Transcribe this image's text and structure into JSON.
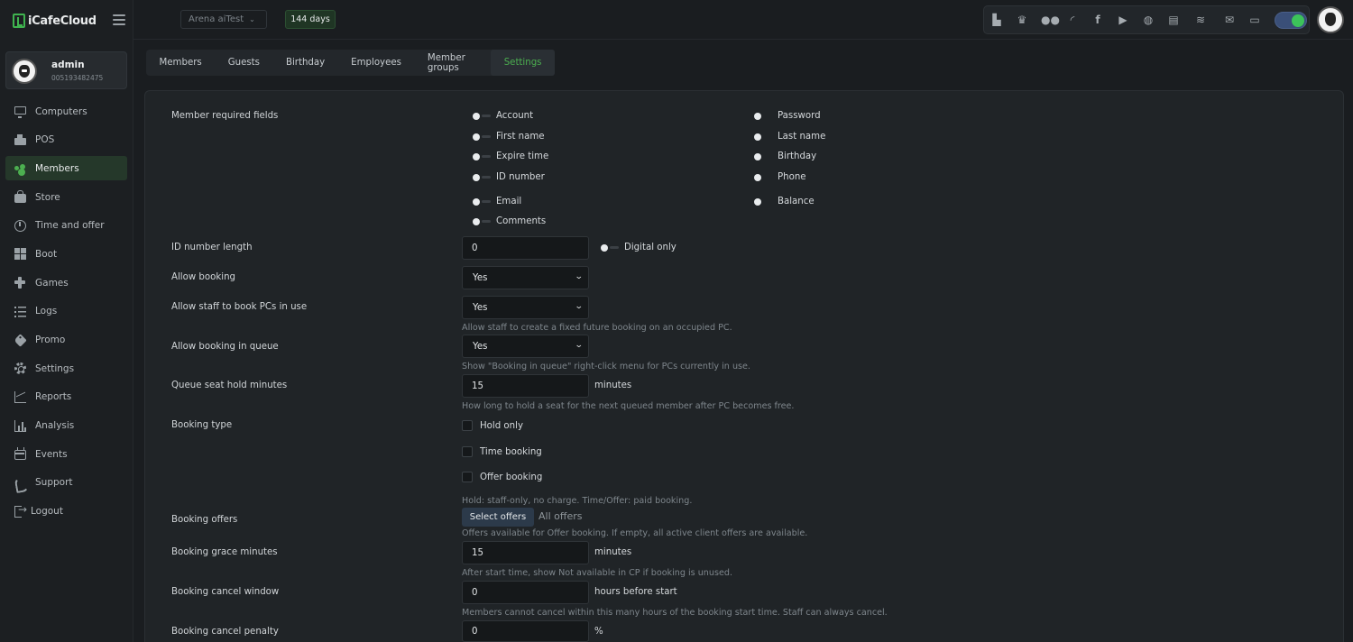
{
  "app": {
    "logo": "iCafeCloud"
  },
  "user": {
    "name": "admin",
    "id": "005193482475"
  },
  "nav": {
    "items": [
      {
        "label": "Computers",
        "icon": "computer-icon"
      },
      {
        "label": "POS",
        "icon": "pos-icon"
      },
      {
        "label": "Members",
        "icon": "members-icon",
        "active": true
      },
      {
        "label": "Store",
        "icon": "store-icon"
      },
      {
        "label": "Time and offer",
        "icon": "clock-icon"
      },
      {
        "label": "Boot",
        "icon": "windows-icon"
      },
      {
        "label": "Games",
        "icon": "gamepad-icon"
      },
      {
        "label": "Logs",
        "icon": "list-icon"
      },
      {
        "label": "Promo",
        "icon": "tag-icon"
      },
      {
        "label": "Settings",
        "icon": "gear-icon"
      },
      {
        "label": "Reports",
        "icon": "line-chart-icon"
      },
      {
        "label": "Analysis",
        "icon": "bar-chart-icon"
      },
      {
        "label": "Events",
        "icon": "calendar-icon"
      },
      {
        "label": "Support",
        "icon": "phone-icon"
      },
      {
        "label": "Logout",
        "icon": "logout-icon"
      }
    ]
  },
  "topbar": {
    "arena": "Arena aiTest",
    "days": "144 days",
    "tray_icons": [
      "dashboard-icon",
      "trophy-icon",
      "users-icon",
      "rss-icon",
      "facebook-icon",
      "youtube-icon",
      "globe-icon",
      "news-icon",
      "handshake-icon",
      "mail-icon",
      "chat-icon"
    ],
    "toggle_on": true,
    "accent": "#3cc35a"
  },
  "tabs": [
    {
      "label": "Members"
    },
    {
      "label": "Guests"
    },
    {
      "label": "Birthday"
    },
    {
      "label": "Employees"
    },
    {
      "label": "Member groups"
    },
    {
      "label": "Settings",
      "active": true
    }
  ],
  "settings": {
    "required_fields": {
      "label": "Member required fields",
      "left": [
        "Account",
        "First name",
        "Expire time",
        "ID number",
        "Email",
        "Comments"
      ],
      "right": [
        "Password",
        "Last name",
        "Birthday",
        "Phone",
        "Balance"
      ]
    },
    "id_length": {
      "label": "ID number length",
      "value": "0",
      "digital_only": "Digital only"
    },
    "allow_booking": {
      "label": "Allow booking",
      "value": "Yes"
    },
    "allow_staff": {
      "label": "Allow staff to book PCs in use",
      "value": "Yes",
      "hint": "Allow staff to create a fixed future booking on an occupied PC."
    },
    "booking_queue": {
      "label": "Allow booking in queue",
      "value": "Yes",
      "hint": "Show \"Booking in queue\" right-click menu for PCs currently in use."
    },
    "queue_hold": {
      "label": "Queue seat hold minutes",
      "value": "15",
      "unit": "minutes",
      "hint": "How long to hold a seat for the next queued member after PC becomes free."
    },
    "booking_type": {
      "label": "Booking type",
      "options": [
        "Hold only",
        "Time booking",
        "Offer booking"
      ],
      "hint": "Hold: staff-only, no charge. Time/Offer: paid booking."
    },
    "booking_offers": {
      "label": "Booking offers",
      "button": "Select offers",
      "selected": "All offers",
      "hint": "Offers available for Offer booking. If empty, all active client offers are available."
    },
    "grace": {
      "label": "Booking grace minutes",
      "value": "15",
      "unit": "minutes",
      "hint": "After start time, show Not available in CP if booking is unused."
    },
    "cancel_window": {
      "label": "Booking cancel window",
      "value": "0",
      "unit": "hours before start",
      "hint": "Members cannot cancel within this many hours of the booking start time. Staff can always cancel."
    },
    "cancel_penalty": {
      "label": "Booking cancel penalty",
      "value": "0",
      "unit": "%"
    }
  }
}
